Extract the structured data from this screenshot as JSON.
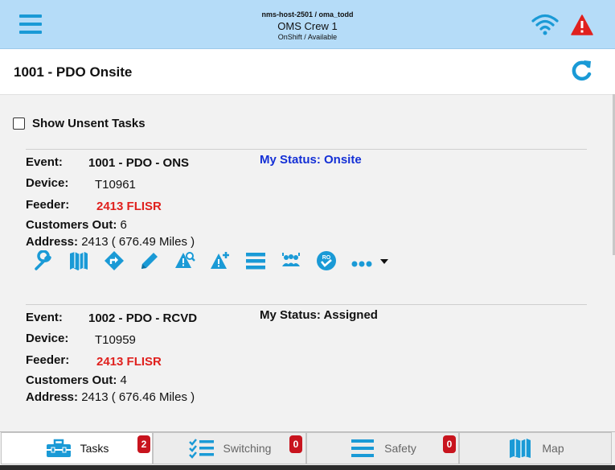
{
  "header": {
    "host": "nms-host-2501 / oma_todd",
    "crew": "OMS Crew 1",
    "shift_status": "OnShift / Available"
  },
  "title_bar": {
    "title": "1001 - PDO Onsite"
  },
  "filters": {
    "show_unsent_label": "Show Unsent Tasks",
    "show_unsent_checked": false
  },
  "labels": {
    "event": "Event:",
    "device": "Device:",
    "feeder": "Feeder:",
    "customers_out": "Customers Out:",
    "address": "Address:"
  },
  "tasks": [
    {
      "event": "1001 - PDO - ONS",
      "status": "My Status: Onsite",
      "device": "T10961",
      "feeder": "2413 FLISR",
      "customers_out": "6",
      "address": "2413 ( 676.49 Miles )"
    },
    {
      "event": "1002 - PDO - RCVD",
      "status": "My Status: Assigned",
      "device": "T10959",
      "feeder": "2413 FLISR",
      "customers_out": "4",
      "address": "2413 ( 676.46 Miles )"
    }
  ],
  "action_icons": [
    "wrench-icon",
    "map-icon",
    "directions-icon",
    "pencil-icon",
    "search-alert-icon",
    "add-alert-icon",
    "list-icon",
    "crew-icon",
    "ro-check-icon",
    "more-icon"
  ],
  "tabs": [
    {
      "label": "Tasks",
      "badge": "2",
      "active": true
    },
    {
      "label": "Switching",
      "badge": "0",
      "active": false
    },
    {
      "label": "Safety",
      "badge": "0",
      "active": false
    },
    {
      "label": "Map",
      "active": false
    }
  ],
  "colors": {
    "header_bg": "#b5dcf8",
    "accent": "#1a9ad6",
    "alert": "#e0211e",
    "status_onsite": "#1430d6",
    "badge": "#c8141e"
  }
}
